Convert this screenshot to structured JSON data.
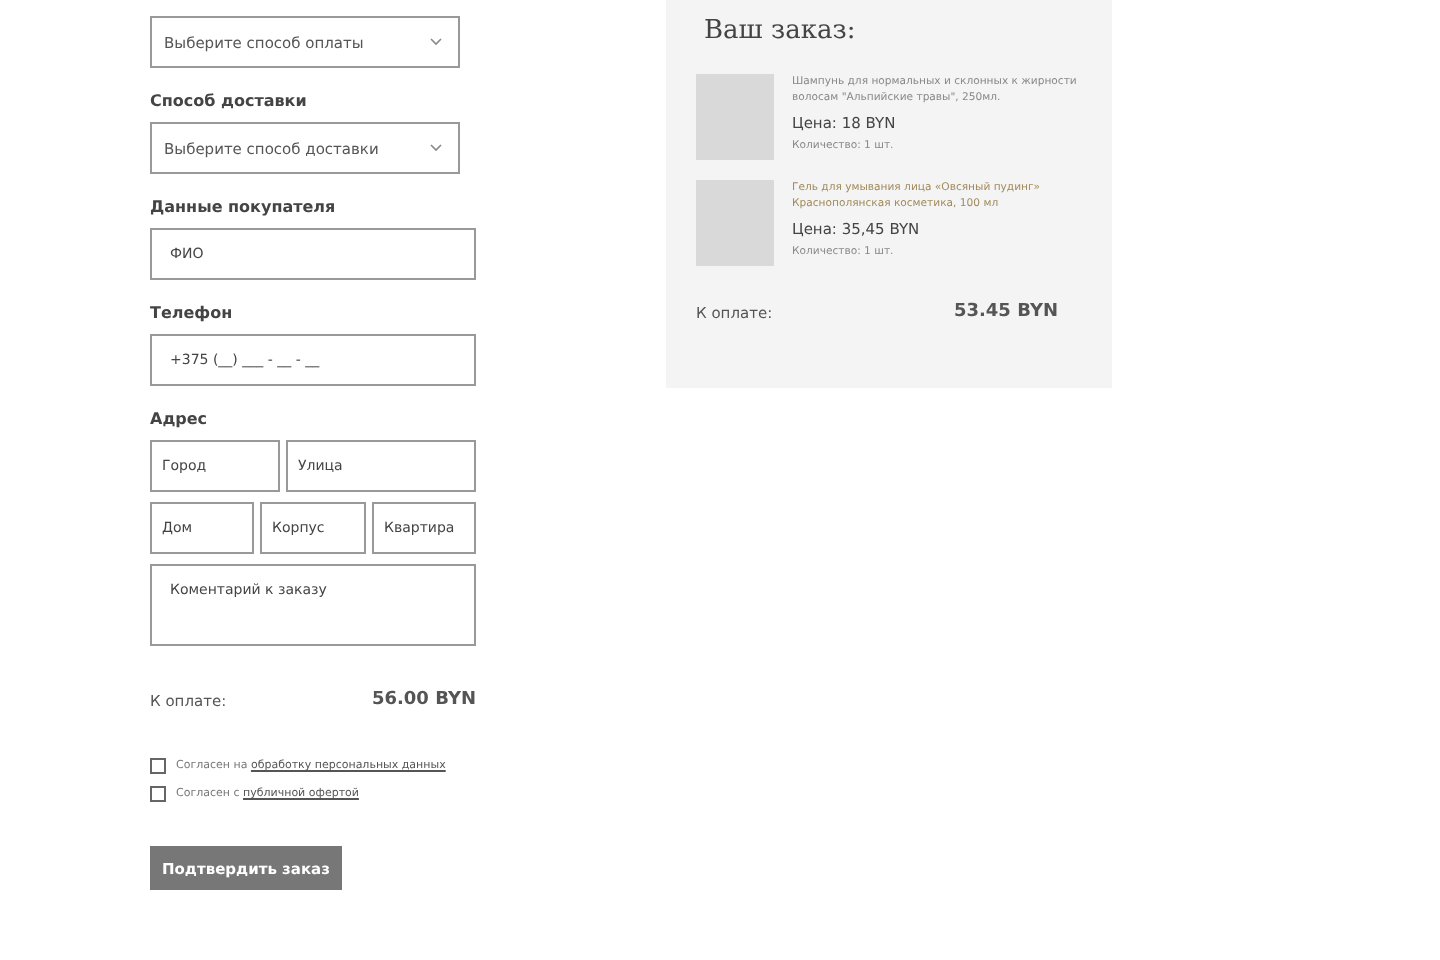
{
  "payment_select": {
    "placeholder": "Выберите способ оплаты"
  },
  "delivery": {
    "label": "Способ доставки",
    "placeholder": "Выберите способ доставки"
  },
  "buyer": {
    "label": "Данные покупателя",
    "placeholder": "ФИО"
  },
  "phone": {
    "label": "Телефон",
    "placeholder": "+375 (__) ___ - __ - __"
  },
  "address": {
    "label": "Адрес",
    "rows": [
      [
        {
          "placeholder": "Город"
        },
        {
          "placeholder": "Улица"
        }
      ],
      [
        {
          "placeholder": "Дом"
        },
        {
          "placeholder": "Корпус"
        },
        {
          "placeholder": "Квартира"
        }
      ]
    ]
  },
  "comment": {
    "placeholder": "Коментарий к заказу"
  },
  "total": {
    "label": "К оплате:",
    "value": "56.00 BYN"
  },
  "consents": [
    {
      "text": "Согласен на",
      "link": "обработку персональных данных",
      "checked": false
    },
    {
      "text": "Согласен с",
      "link": "публичной офертой",
      "checked": false
    }
  ],
  "submit": "Подтвердить заказ",
  "order": {
    "title": "Ваш заказ:",
    "items": [
      {
        "name": "Шампунь для нормальных и склонных к жирности волосам \"Альпийские травы\", 250мл.",
        "highlighted": false,
        "price": "Цена: 18 BYN",
        "qty": "Количество: 1 шт."
      },
      {
        "name": "Гель для умывания лица «Овсяный пудинг» Краснополянская косметика, 100 мл",
        "highlighted": true,
        "price": "Цена: 35,45 BYN",
        "qty": "Количество: 1 шт."
      }
    ],
    "total_label": "К оплате:",
    "total_value": "53.45 BYN"
  }
}
